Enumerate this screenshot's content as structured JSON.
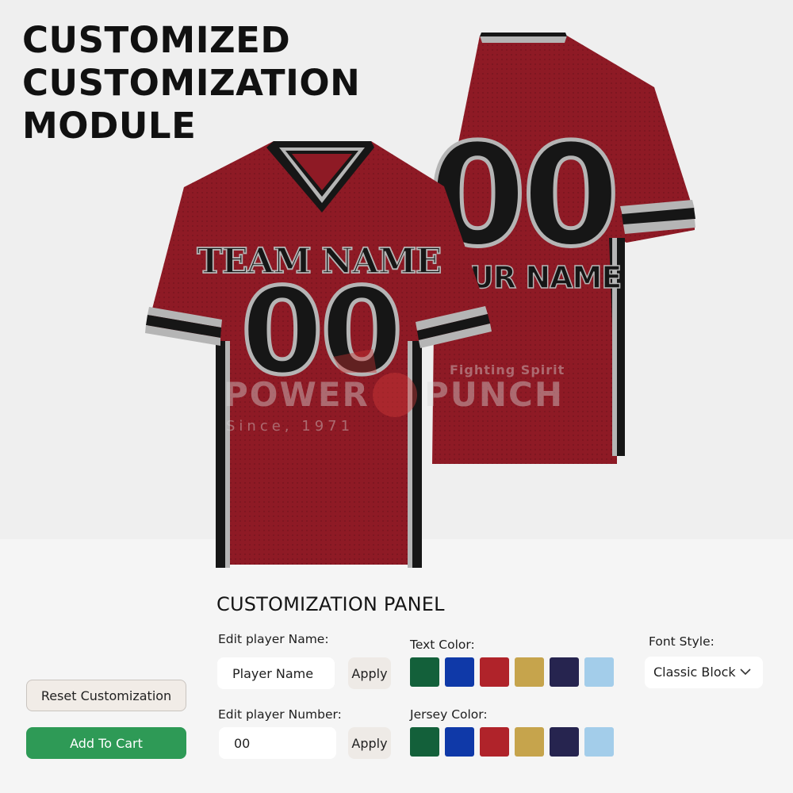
{
  "hero": {
    "title_lines": [
      "CUSTOMIZED",
      "CUSTOMIZATION",
      "MODULE"
    ]
  },
  "jersey": {
    "front_team_text": "TEAM NAME",
    "front_number": "00",
    "back_number": "00",
    "back_name_text": "OUR NAME",
    "base_color": "#8e1a25",
    "trim_dark": "#161616",
    "trim_light": "#b5b5b5"
  },
  "watermark": {
    "left_word": "POWER",
    "right_word": "PUNCH",
    "tagline": "Fighting Spirit",
    "since": "Since, 1971"
  },
  "panel": {
    "title": "CUSTOMIZATION PANEL",
    "name_label": "Edit player Name:",
    "name_value": "Player Name",
    "number_label": "Edit player Number:",
    "number_value": "00",
    "apply_label": "Apply",
    "text_color_label": "Text Color:",
    "jersey_color_label": "Jersey Color:",
    "font_style_label": "Font Style:",
    "font_style_value": "Classic Block",
    "colors": [
      "#13603a",
      "#0f39a8",
      "#b0232a",
      "#c6a44c",
      "#26244f",
      "#a3cdea"
    ]
  },
  "actions": {
    "reset_label": "Reset Customization",
    "cart_label": "Add To Cart"
  }
}
